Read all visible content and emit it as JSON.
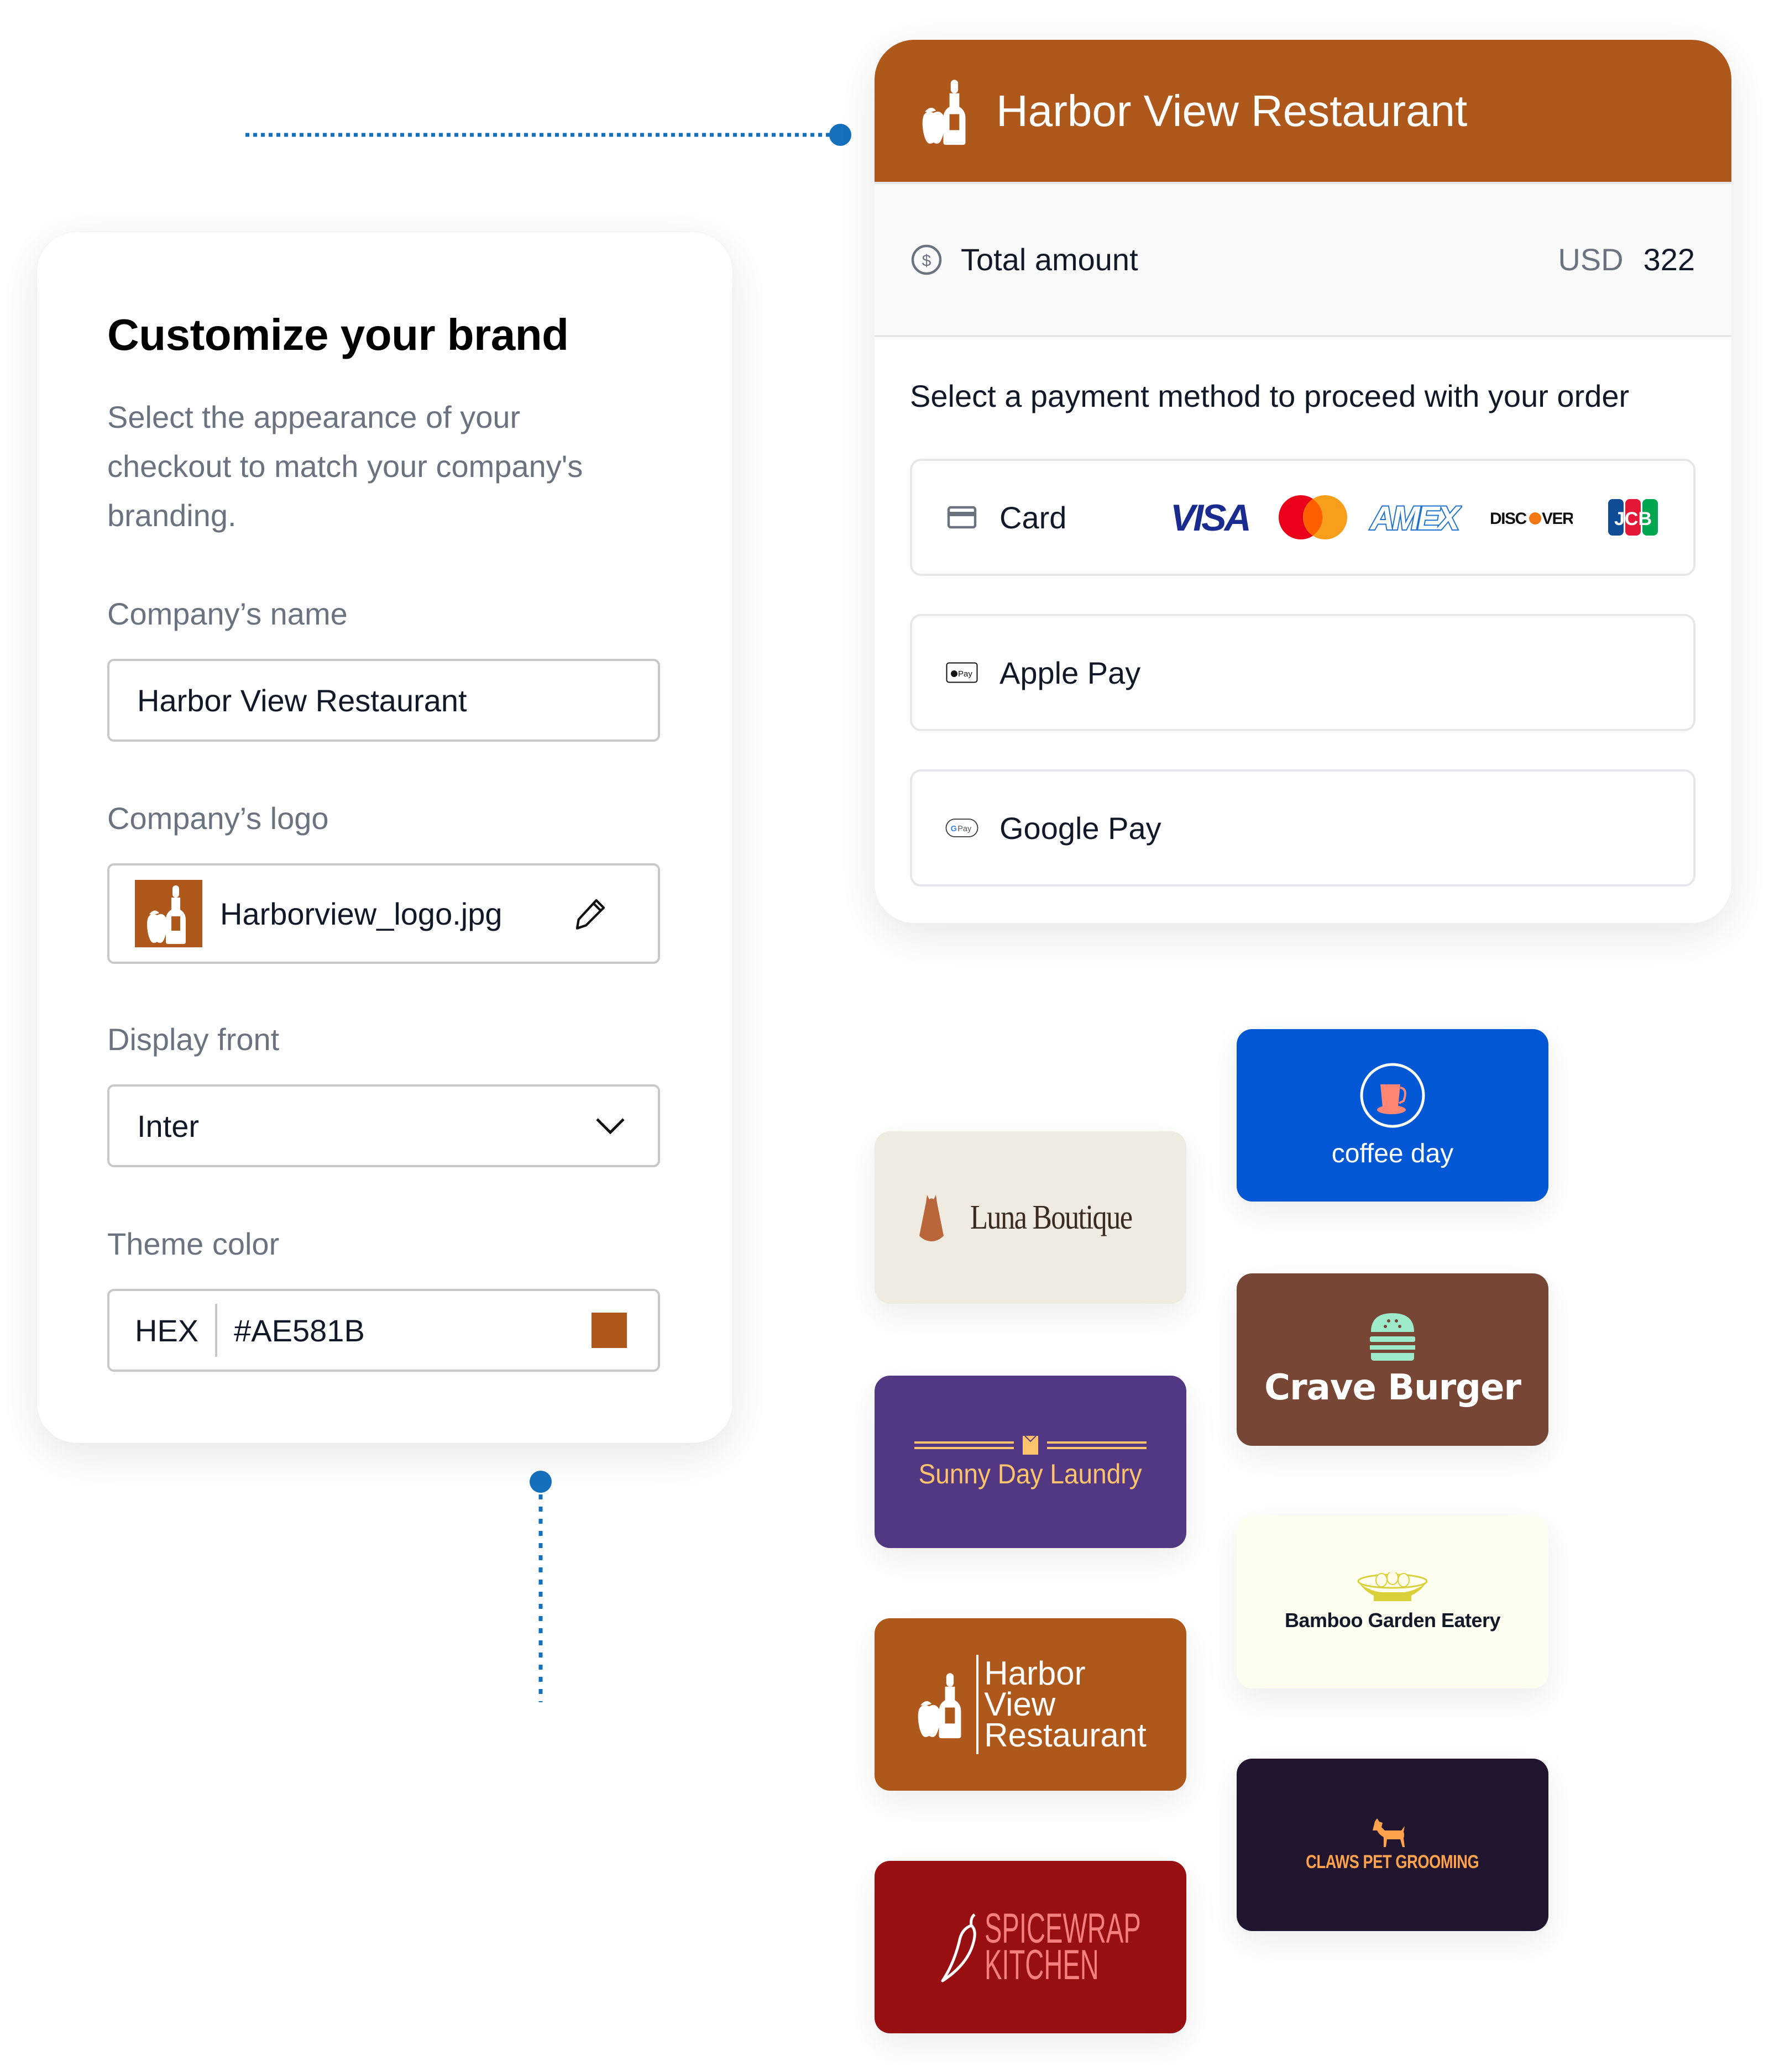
{
  "brand_panel": {
    "title": "Customize your brand",
    "description": "Select the appearance of your checkout to match your company's branding.",
    "company_name": {
      "label": "Company’s name",
      "value": "Harbor View Restaurant"
    },
    "company_logo": {
      "label": "Company’s logo",
      "file_name": "Harborview_logo.jpg",
      "edit_icon": "pencil-icon"
    },
    "display_font": {
      "label": "Display front",
      "selected": "Inter",
      "icon": "chevron-down-icon"
    },
    "theme_color": {
      "label": "Theme color",
      "format": "HEX",
      "value": "#AE581B",
      "swatch_color": "#AE581B"
    }
  },
  "checkout_preview": {
    "header_title": "Harbor View Restaurant",
    "header_color": "#AE581B",
    "total_label": "Total amount",
    "currency": "USD",
    "amount": "322",
    "prompt": "Select a payment method to proceed with your order",
    "payment_methods": [
      {
        "label": "Card",
        "icon": "credit-card-icon",
        "brands": [
          "VISA",
          "Mastercard",
          "AMEX",
          "DISCOVER",
          "JCB"
        ]
      },
      {
        "label": "Apple Pay",
        "icon": "apple-pay-icon",
        "badge": "Pay"
      },
      {
        "label": "Google Pay",
        "icon": "google-pay-icon",
        "badge": "Pay"
      }
    ]
  },
  "brand_tiles": [
    {
      "name": "Luna Boutique",
      "bg": "#F0EBE1",
      "fg": "#3B2A20",
      "icon": "dress-icon"
    },
    {
      "name": "coffee day",
      "bg": "#0257D5",
      "fg": "#FFFFFF",
      "icon": "coffee-cup-icon"
    },
    {
      "name": "Crave Burger",
      "bg": "#774634",
      "fg": "#FFFFFF",
      "icon": "burger-icon"
    },
    {
      "name": "Sunny Day Laundry",
      "bg": "#523783",
      "fg": "#FFC46B",
      "icon": "shirt-icon"
    },
    {
      "name": "Bamboo Garden Eatery",
      "bg": "#FDFDF0",
      "fg": "#111827",
      "icon": "dumpling-bowl-icon"
    },
    {
      "name_lines": [
        "Harbor",
        "View",
        "Restaurant"
      ],
      "name": "Harbor View Restaurant",
      "bg": "#AE581B",
      "fg": "#FFFFFF",
      "icon": "wine-apple-icon"
    },
    {
      "name": "CLAWS PET GROOMING",
      "bg": "#21142F",
      "fg": "#FFA24C",
      "icon": "dog-icon"
    },
    {
      "name_lines": [
        "SPICEWRAP",
        "KITCHEN"
      ],
      "name": "Spicewrap Kitchen",
      "bg": "#980F12",
      "fg": "#F67F7F",
      "icon": "chili-pepper-icon"
    }
  ],
  "colors": {
    "connector": "#1570BD",
    "label_gray": "#6B7280",
    "border": "#C9C9C9"
  }
}
